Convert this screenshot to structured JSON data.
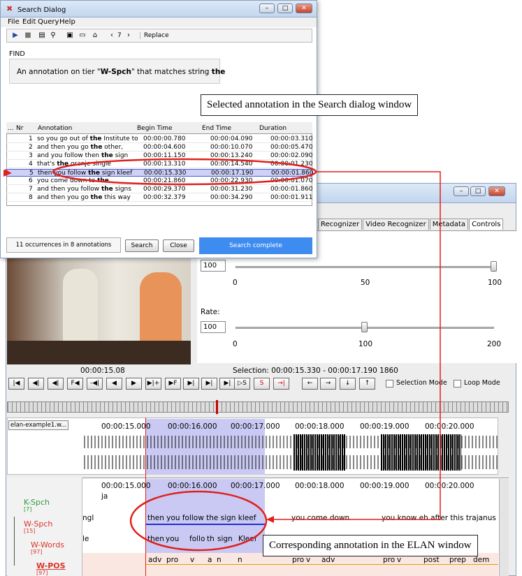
{
  "search": {
    "title": "Search Dialog",
    "menu": [
      "File",
      "Edit",
      "Query",
      "Help"
    ],
    "counter": "7",
    "replace_label": "Replace",
    "find_label": "FIND",
    "query_prefix": "An annotation on tier \"",
    "query_tier": "W-Spch",
    "query_mid": "\" that matches string ",
    "query_string": "the",
    "columns": [
      "...",
      "Nr",
      "Annotation",
      "Begin Time",
      "End Time",
      "Duration"
    ],
    "rows": [
      {
        "nr": "1",
        "pre": "so you go out of ",
        "hit": "the",
        "post": " Institute to",
        "begin": "00:00:00.780",
        "end": "00:00:04.090",
        "dur": "00:00:03.310"
      },
      {
        "nr": "2",
        "pre": "and then you go ",
        "hit": "the",
        "post": " other,",
        "begin": "00:00:04.600",
        "end": "00:00:10.070",
        "dur": "00:00:05.470"
      },
      {
        "nr": "3",
        "pre": "and you follow then ",
        "hit": "the",
        "post": " sign",
        "begin": "00:00:11.150",
        "end": "00:00:13.240",
        "dur": "00:00:02.090"
      },
      {
        "nr": "4",
        "pre": "that's ",
        "hit": "the",
        "post": " oranje single",
        "begin": "00:00:13.310",
        "end": "00:00:14.540",
        "dur": "00:00:01.230"
      },
      {
        "nr": "5",
        "pre": "then you follow ",
        "hit": "the",
        "post": " sign kleef",
        "begin": "00:00:15.330",
        "end": "00:00:17.190",
        "dur": "00:00:01.860"
      },
      {
        "nr": "6",
        "pre": "you come down to ",
        "hit": "the",
        "post": "",
        "begin": "00:00:21.860",
        "end": "00:00:22.930",
        "dur": "00:00:01.070"
      },
      {
        "nr": "7",
        "pre": "and then you follow ",
        "hit": "the",
        "post": " signs",
        "begin": "00:00:29.370",
        "end": "00:00:31.230",
        "dur": "00:00:01.860"
      },
      {
        "nr": "8",
        "pre": "and then you go ",
        "hit": "the",
        "post": " this way",
        "begin": "00:00:32.379",
        "end": "00:00:34.290",
        "dur": "00:00:01.911"
      }
    ],
    "selected_row": 5,
    "occurrences": "11 occurrences in 8 annotations",
    "search_button": "Search",
    "close_button": "Close",
    "status": "Search complete"
  },
  "elan": {
    "tabs": [
      "Recognizer",
      "Video Recognizer",
      "Metadata",
      "Controls"
    ],
    "active_tab": "Controls",
    "volume_value": "100",
    "volume_ticks": [
      "0",
      "50",
      "100"
    ],
    "rate_label": "Rate:",
    "rate_value": "100",
    "rate_ticks": [
      "0",
      "100",
      "200"
    ],
    "current_time": "00:00:15.08",
    "selection": "Selection: 00:00:15.330 - 00:00:17.190  1860",
    "selection_mode": "Selection Mode",
    "loop_mode": "Loop Mode",
    "media_buttons": [
      "|◀",
      "◀|",
      "◀|",
      "F◀",
      "-◀|",
      "◀",
      "▶",
      "▶|+",
      "▶F",
      "▶|",
      "▶|",
      "▶|"
    ],
    "media_buttons_b": [
      "▷S",
      "S",
      "→|"
    ],
    "media_buttons_c": [
      "←",
      "→",
      "↓",
      "↑"
    ],
    "file_name": "elan-example1.w...",
    "timeline_ticks": [
      "00:00:15.000",
      "00:00:16.000",
      "00:00:17.000",
      "00:00:18.000",
      "00:00:19.000",
      "00:00:20.000"
    ],
    "tiers": [
      {
        "name": "K-Spch",
        "count": "[7]",
        "color": "#2e9b3c"
      },
      {
        "name": "W-Spch",
        "count": "[15]",
        "color": "#d8352a"
      },
      {
        "name": "W-Words",
        "count": "[97]",
        "color": "#d8352a"
      },
      {
        "name": "W-POS",
        "count": "[97]",
        "color": "#d8352a"
      }
    ],
    "kspch_annotation": "ja",
    "wspch_annotations": [
      "ngl",
      "then you follow the sign kleef",
      "you come down",
      "you know eh after this trajanus pl"
    ],
    "wwords_annotations": [
      "le",
      "then",
      "you",
      "follo",
      "th",
      "sign",
      "Kleef"
    ],
    "wpos_annotations": [
      "adv",
      "pro",
      "v",
      "a",
      "n",
      "n",
      "pro",
      "v",
      "adv",
      "pro",
      "v",
      "post",
      "prep",
      "dem"
    ]
  },
  "callouts": {
    "top": "Selected annotation in the Search dialog window",
    "bottom": "Corresponding annotation in the ELAN window"
  },
  "colors": {
    "highlight": "#c9c9f4",
    "red": "#e0201b",
    "blue_status": "#3f8cf0"
  }
}
